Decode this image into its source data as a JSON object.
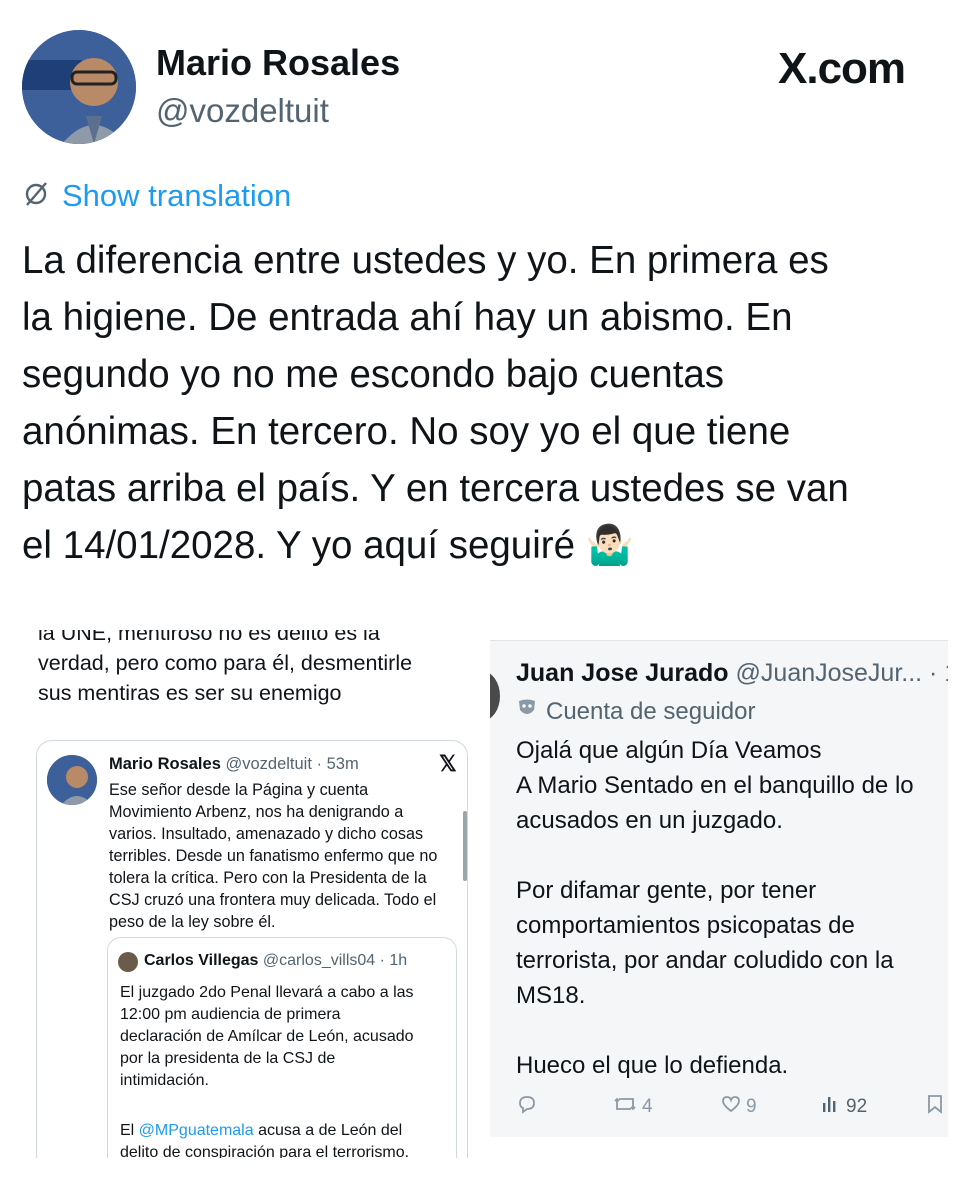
{
  "header": {
    "name": "Mario Rosales",
    "handle": "@vozdeltuit",
    "platform": "X.com"
  },
  "translation_link": "Show translation",
  "tweet": {
    "lines": [
      "La diferencia entre ustedes y yo. En primera es",
      "la higiene. De entrada ahí hay un abismo. En",
      "segundo yo no me escondo bajo cuentas",
      "anónimas. En tercero. No soy yo el que tiene",
      "patas arriba el país. Y en tercera ustedes se van",
      "el 14/01/2028. Y yo aquí seguiré 🤷🏻‍♂️"
    ]
  },
  "left_screenshot": {
    "fragment_lines": [
      "la UNE, mentiroso no es delito es la",
      "verdad, pero como para él, desmentirle",
      "sus mentiras es ser su enemigo"
    ],
    "card": {
      "name": "Mario Rosales",
      "meta": "@vozdeltuit · 53m",
      "body_lines": [
        "Ese señor desde la Página y cuenta",
        "Movimiento Arbenz, nos ha denigrando a",
        "varios. Insultado, amenazado y dicho cosas",
        "terribles. Desde un fanatismo enfermo que no",
        "tolera la crítica. Pero con la Presidenta de la",
        "CSJ cruzó una frontera muy delicada. Todo el",
        "peso de la ley sobre él."
      ],
      "quote": {
        "name": "Carlos Villegas",
        "meta": "@carlos_vills04 · 1h",
        "body_lines": [
          "El juzgado 2do Penal llevará a cabo a las",
          "12:00 pm audiencia de primera",
          "declaración de Amílcar de León, acusado",
          "por la presidenta de la CSJ de",
          "intimidación."
        ],
        "body2_prefix": "El ",
        "body2_mention": "@MPguatemala",
        "body2_rest": " acusa a de León del",
        "body2_line2": "delito de conspiración para el terrorismo."
      }
    }
  },
  "right_screenshot": {
    "name": "Juan Jose Jurado",
    "meta": "@JuanJoseJur... · 1",
    "follower_label": "Cuenta de seguidor",
    "body_lines": [
      "Ojalá que algún Día Veamos",
      "A Mario Sentado en el banquillo de lo",
      "acusados en un juzgado.",
      "",
      "Por difamar gente, por tener",
      "comportamientos psicopatas de",
      "terrorista, por andar coludido con la",
      "MS18.",
      "",
      "Hueco el que lo defienda."
    ],
    "actions": {
      "reposts": "4",
      "likes": "9",
      "views": "92"
    }
  }
}
